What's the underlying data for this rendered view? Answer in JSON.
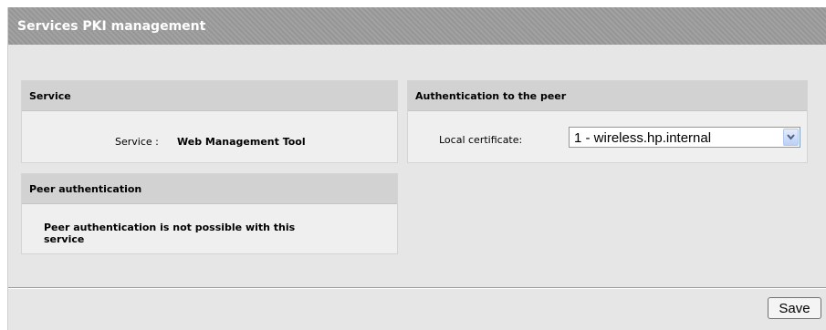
{
  "header": {
    "title": "Services PKI management"
  },
  "service_panel": {
    "title": "Service",
    "label": "Service :",
    "value": "Web Management Tool"
  },
  "auth_panel": {
    "title": "Authentication to the peer",
    "local_certificate_label": "Local certificate:",
    "local_certificate_value": "1 - wireless.hp.internal"
  },
  "peer_panel": {
    "title": "Peer authentication",
    "message_line1": "Peer authentication is not possible with this",
    "message_line2": "service"
  },
  "footer": {
    "save_label": "Save"
  },
  "colors": {
    "title_bar": "#9c9c9c",
    "panel_header": "#d2d2d2",
    "panel_body": "#efefef",
    "page_background": "#e6e6e6"
  },
  "icons": {
    "select_arrow": "chevron-down-icon"
  }
}
